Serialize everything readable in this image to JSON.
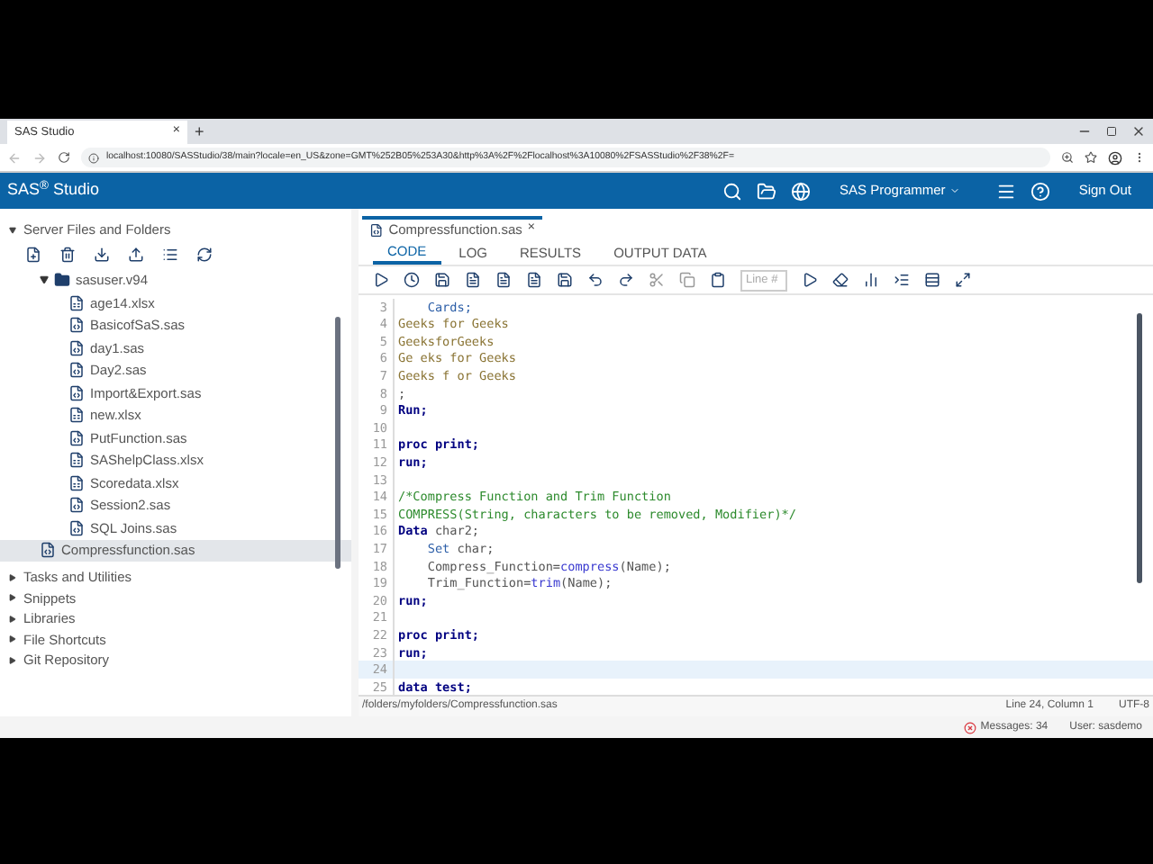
{
  "browser": {
    "tab": {
      "title": "SAS Studio",
      "close": "×"
    },
    "new_tab": "+",
    "url": "localhost:10080/SASStudio/38/main?locale=en_US&zone=GMT%252B05%253A30&http%3A%2F%2Flocalhost%3A10080%2FSASStudio%2F38%2F="
  },
  "header": {
    "title": "SAS$^{®}$ Studio",
    "perspective": "SAS Programmer",
    "sign_out": "Sign Out"
  },
  "sidebar": {
    "sections": [
      {
        "label": "Server Files and Folders",
        "expanded": true,
        "tree": [
          {
            "label": "sasuser.v94",
            "kind": "folder",
            "expanded": true,
            "selected": false,
            "children": [
              {
                "label": "age14.xlsx",
                "kind": "xlsx",
                "selected": false
              },
              {
                "label": "BasicofSaS.sas",
                "kind": "sas",
                "selected": false
              },
              {
                "label": "day1.sas",
                "kind": "sas",
                "selected": false
              },
              {
                "label": "Day2.sas",
                "kind": "sas",
                "selected": false
              },
              {
                "label": "Import&Export.sas",
                "kind": "sas",
                "selected": false
              },
              {
                "label": "new.xlsx",
                "kind": "xlsx",
                "selected": false
              },
              {
                "label": "PutFunction.sas",
                "kind": "sas",
                "selected": false
              },
              {
                "label": "SAShelpClass.xlsx",
                "kind": "xlsx",
                "selected": false
              },
              {
                "label": "Scoredata.xlsx",
                "kind": "xlsx",
                "selected": false
              },
              {
                "label": "Session2.sas",
                "kind": "sas",
                "selected": false
              },
              {
                "label": "SQL Joins.sas",
                "kind": "sas",
                "selected": false
              }
            ]
          },
          {
            "label": "Compressfunction.sas",
            "kind": "sas",
            "selected": true
          }
        ]
      },
      {
        "label": "Tasks and Utilities",
        "expanded": false
      },
      {
        "label": "Snippets",
        "expanded": false
      },
      {
        "label": "Libraries",
        "expanded": false
      },
      {
        "label": "File Shortcuts",
        "expanded": false
      },
      {
        "label": "Git Repository",
        "expanded": false
      }
    ]
  },
  "editor": {
    "file_tab": {
      "title": "Compressfunction.sas",
      "close": "×"
    },
    "tabs": [
      {
        "label": "CODE",
        "selected": true
      },
      {
        "label": "LOG",
        "selected": false
      },
      {
        "label": "RESULTS",
        "selected": false
      },
      {
        "label": "OUTPUT DATA",
        "selected": false
      }
    ],
    "line_field": {
      "placeholder": "Line #"
    },
    "lines": [
      {
        "num": "3",
        "current": false,
        "tokens": [
          {
            "text": "    Cards;",
            "kind": "stmt"
          }
        ]
      },
      {
        "num": "4",
        "current": false,
        "tokens": [
          {
            "text": "Geeks for Geeks",
            "kind": "data"
          }
        ]
      },
      {
        "num": "5",
        "current": false,
        "tokens": [
          {
            "text": "GeeksforGeeks",
            "kind": "data"
          }
        ]
      },
      {
        "num": "6",
        "current": false,
        "tokens": [
          {
            "text": "Ge eks for Geeks",
            "kind": "data"
          }
        ]
      },
      {
        "num": "7",
        "current": false,
        "tokens": [
          {
            "text": "Geeks f or Geeks",
            "kind": "data"
          }
        ]
      },
      {
        "num": "8",
        "current": false,
        "tokens": [
          {
            "text": ";",
            "kind": "plain"
          }
        ]
      },
      {
        "num": "9",
        "current": false,
        "tokens": [
          {
            "text": "Run;",
            "kind": "keyword"
          }
        ]
      },
      {
        "num": "10",
        "current": false
      },
      {
        "num": "11",
        "current": false,
        "tokens": [
          {
            "text": "proc print;",
            "kind": "keyword"
          }
        ]
      },
      {
        "num": "12",
        "current": false,
        "tokens": [
          {
            "text": "run;",
            "kind": "keyword"
          }
        ]
      },
      {
        "num": "13",
        "current": false
      },
      {
        "num": "14",
        "current": false,
        "tokens": [
          {
            "text": "/*Compress Function and Trim Function",
            "kind": "comment"
          }
        ]
      },
      {
        "num": "15",
        "current": false,
        "tokens": [
          {
            "text": "COMPRESS(String, characters to be removed, Modifier)*/",
            "kind": "comment"
          }
        ]
      },
      {
        "num": "16",
        "current": false,
        "tokens": [
          {
            "text": "Data",
            "kind": "keyword"
          },
          {
            "text": " char2;",
            "kind": "plain"
          }
        ]
      },
      {
        "num": "17",
        "current": false,
        "tokens": [
          {
            "text": "    Set",
            "kind": "stmt"
          },
          {
            "text": " char;",
            "kind": "plain"
          }
        ]
      },
      {
        "num": "18",
        "current": false,
        "tokens": [
          {
            "text": "    Compress_Function=",
            "kind": "plain"
          },
          {
            "text": "compress",
            "kind": "function"
          },
          {
            "text": "(Name);",
            "kind": "plain"
          }
        ]
      },
      {
        "num": "19",
        "current": false,
        "tokens": [
          {
            "text": "    Trim_Function=",
            "kind": "plain"
          },
          {
            "text": "trim",
            "kind": "function"
          },
          {
            "text": "(Name);",
            "kind": "plain"
          }
        ]
      },
      {
        "num": "20",
        "current": false,
        "tokens": [
          {
            "text": "run;",
            "kind": "keyword"
          }
        ]
      },
      {
        "num": "21",
        "current": false
      },
      {
        "num": "22",
        "current": false,
        "tokens": [
          {
            "text": "proc print;",
            "kind": "keyword"
          }
        ]
      },
      {
        "num": "23",
        "current": false,
        "tokens": [
          {
            "text": "run;",
            "kind": "keyword"
          }
        ]
      },
      {
        "num": "24",
        "current": true
      },
      {
        "num": "25",
        "current": false,
        "tokens": [
          {
            "text": "data test;",
            "kind": "keyword"
          }
        ]
      }
    ],
    "status": {
      "path": "/folders/myfolders/Compressfunction.sas",
      "position": "Line 24, Column 1",
      "encoding": "UTF-8"
    }
  },
  "footer": {
    "messages": "Messages: 34",
    "user": "User: sasdemo"
  }
}
